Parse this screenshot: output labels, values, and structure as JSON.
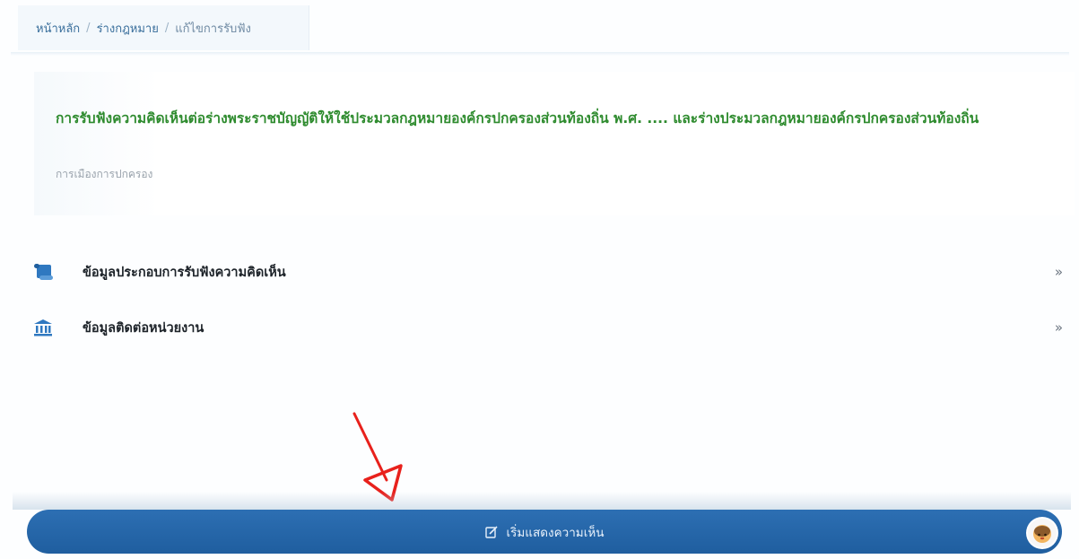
{
  "breadcrumb": {
    "items": [
      {
        "label": "หน้าหลัก"
      },
      {
        "label": "ร่างกฎหมาย"
      },
      {
        "label": "แก้ไขการรับฟัง"
      }
    ],
    "separator": "/"
  },
  "main": {
    "title": "การรับฟังความคิดเห็นต่อร่างพระราชบัญญัติให้ใช้ประมวลกฎหมายองค์กรปกครองส่วนท้องถิ่น พ.ศ. .... และร่างประมวลกฎหมายองค์กรปกครองส่วนท้องถิ่น",
    "category": "การเมืองการปกครอง"
  },
  "info_rows": [
    {
      "label": "ข้อมูลประกอบการรับฟังความคิดเห็น",
      "icon": "scroll-icon",
      "chevron": "»"
    },
    {
      "label": "ข้อมูลติดต่อหน่วยงาน",
      "icon": "government-building-icon",
      "chevron": "»"
    }
  ],
  "action_bar": {
    "button_label": "เริ่มแสดงความเห็น",
    "button_icon": "edit-icon"
  },
  "colors": {
    "title_green": "#2e8b2e",
    "button_blue": "#2566a9",
    "breadcrumb_blue": "#3a6f9c",
    "annotation_red": "#e8211c"
  }
}
